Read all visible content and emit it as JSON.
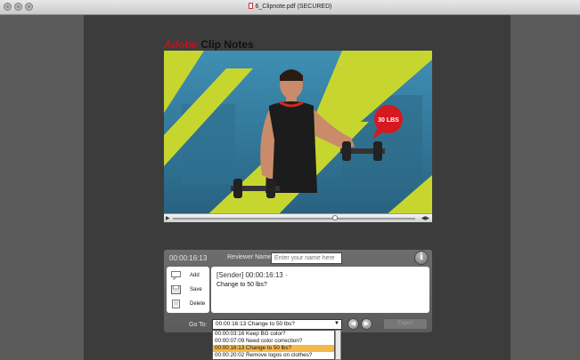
{
  "window": {
    "title": "6_Clipnote.pdf (SECURED)"
  },
  "header": {
    "brand_adobe": "Adobe",
    "brand_title": "Clip Notes"
  },
  "video": {
    "badge_text": "30 LBS",
    "playback_progress": 0.67
  },
  "panel": {
    "timecode": "00:00:16:13",
    "reviewer_label": "Reviewer Name",
    "reviewer_placeholder": "Enter your name here",
    "info_glyph": "i",
    "tools": [
      {
        "label": "Add",
        "icon": "add-note-icon"
      },
      {
        "label": "Save",
        "icon": "save-note-icon"
      },
      {
        "label": "Delete",
        "icon": "delete-note-icon"
      }
    ],
    "note": {
      "sender_line": "[Sender] 00:00:16:13 ·",
      "text": "Change to 50 lbs?"
    },
    "goto_label": "Go To:",
    "goto_selected": "00:00:16:13 Change to 50 lbs?",
    "goto_options": [
      "00:00:03:16 Keep BG color?",
      "00:00:07:09 Need color correction?",
      "00:00:16:13 Change to 50 lbs?",
      "00:00:20:02 Remove logos on clothes?"
    ],
    "goto_selected_index": 2,
    "export_label": "Export"
  },
  "colors": {
    "accent_red": "#c0121b",
    "selection": "#f5b94b",
    "video_green": "#c7d62f"
  }
}
